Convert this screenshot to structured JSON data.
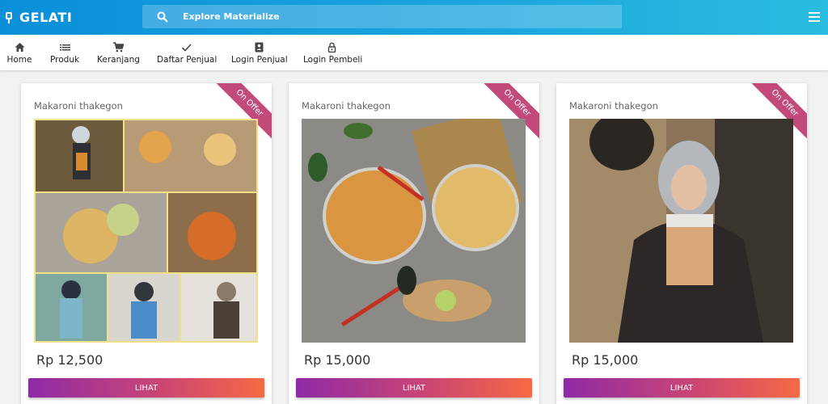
{
  "header": {
    "brand": "GELATI",
    "search_placeholder": "Explore Materialize"
  },
  "nav": [
    {
      "label": "Home",
      "icon": "home-icon"
    },
    {
      "label": "Produk",
      "icon": "list-icon"
    },
    {
      "label": "Keranjang",
      "icon": "cart-icon"
    },
    {
      "label": "Daftar Penjual",
      "icon": "check-icon"
    },
    {
      "label": "Login Penjual",
      "icon": "contact-icon"
    },
    {
      "label": "Login Pembeli",
      "icon": "lock-icon"
    }
  ],
  "products": [
    {
      "title": "Makaroni thakegon",
      "badge": "On Offer",
      "price": "Rp 12,500",
      "button": "LIHAT"
    },
    {
      "title": "Makaroni thakegon",
      "badge": "On Offer",
      "price": "Rp 15,000",
      "button": "LIHAT"
    },
    {
      "title": "Makaroni thakegon",
      "badge": "On Offer",
      "price": "Rp 15,000",
      "button": "LIHAT"
    }
  ],
  "colors": {
    "topbar_start": "#0b8fd9",
    "topbar_end": "#2bbde0",
    "ribbon": "#c24a7a",
    "button_start": "#8e2aa6",
    "button_end": "#f56a43"
  }
}
